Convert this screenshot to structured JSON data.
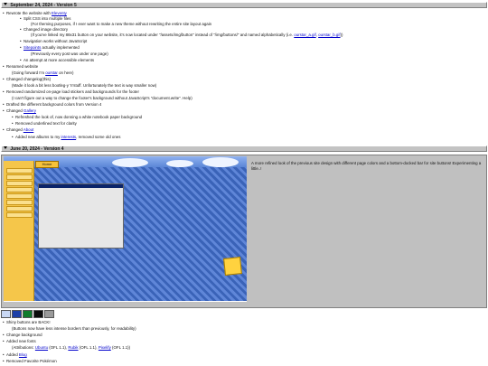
{
  "v5": {
    "header": "September 24, 2024 - Version 5",
    "l1_pre": "Rewrote the website with ",
    "l1_link": "Eleventy",
    "l2": "Split CSS into multiple files",
    "l3": "(For theming purposes, if I ever want to make a new theme without rewriting the entire site layout again",
    "l4": "Changed image directory",
    "l5_pre": "(If you've linked my 88x31 button on your website, it's now located under \"/assets/img/button\" instead of \"/img/buttons/\" and named alphabetically (i.e. ",
    "l5_link1": "ourstar_a.gif",
    "l5_mid": ", ",
    "l5_link2": "ourstar_b.gif",
    "l5_post": "))",
    "l6": "Navigation works without JavaScript",
    "l7_link": "Sitepoints",
    "l7_post": " actually implemented",
    "l8": "(Previously every post was under one page)",
    "l9": "An attempt at more accessible elements",
    "l10": "Renamed website",
    "l11_pre": "(Going forward I'm ",
    "l11_link": "ourstar",
    "l11_post": " on here)",
    "l12": "Changed changelog(this)",
    "l13": "(Made it look a bit less bootleg-y 'n'stuff. Unfortunately the text is way smaller now)",
    "l14": "Removed randomized on-page load stickers and backgrounds for the footer",
    "l15": "(I can't figure out a way to change the footer's background without JavaScript's \"document.write\". Help)",
    "l16": "Drafted the different background colors from Version 4",
    "l17_pre": "Changed ",
    "l17_link": "Gallery",
    "l18": "Refreshed the look of, now donning a white notebook paper background",
    "l19": "Removed underlined text for clarity",
    "l20_pre": "Changed ",
    "l20_link": "About",
    "l21_pre": "Added new albums to my ",
    "l21_link": "interests",
    "l21_post": ", removed some old ones"
  },
  "v4": {
    "header": "June 20, 2024 - Version 4",
    "caption": "A more refined look of the previous site design with different page colors and a bottom-docked bar for site buttons! Experimenting a little..!",
    "home_label": "Home",
    "l1": "Shiny buttons are BACK!",
    "l2": "(Buttons now have less intense borders than previously, for readability)",
    "l3": "Change background",
    "l4": "Added new fonts",
    "l5_pre": "(Attributions: ",
    "l5_link1": "Ubuntu",
    "l5_mid1": " (OFL 1.1), ",
    "l5_link2": "Rubik",
    "l5_mid2": " (OFL 1.1), ",
    "l5_link3": "Pixelify",
    "l5_post": " (OFL 1.1))",
    "l6_pre": "Added ",
    "l6_link": "Blog",
    "l7": "Removed Favorite Pokémon"
  },
  "colors": {
    "header_bg": "#c3c3c3",
    "link": "#0000cc",
    "swatches": [
      "#c9d8f4",
      "#1d3fa7",
      "#0f7c2c",
      "#0b0b0b",
      "#9a9a9a",
      "#ffffff"
    ]
  }
}
